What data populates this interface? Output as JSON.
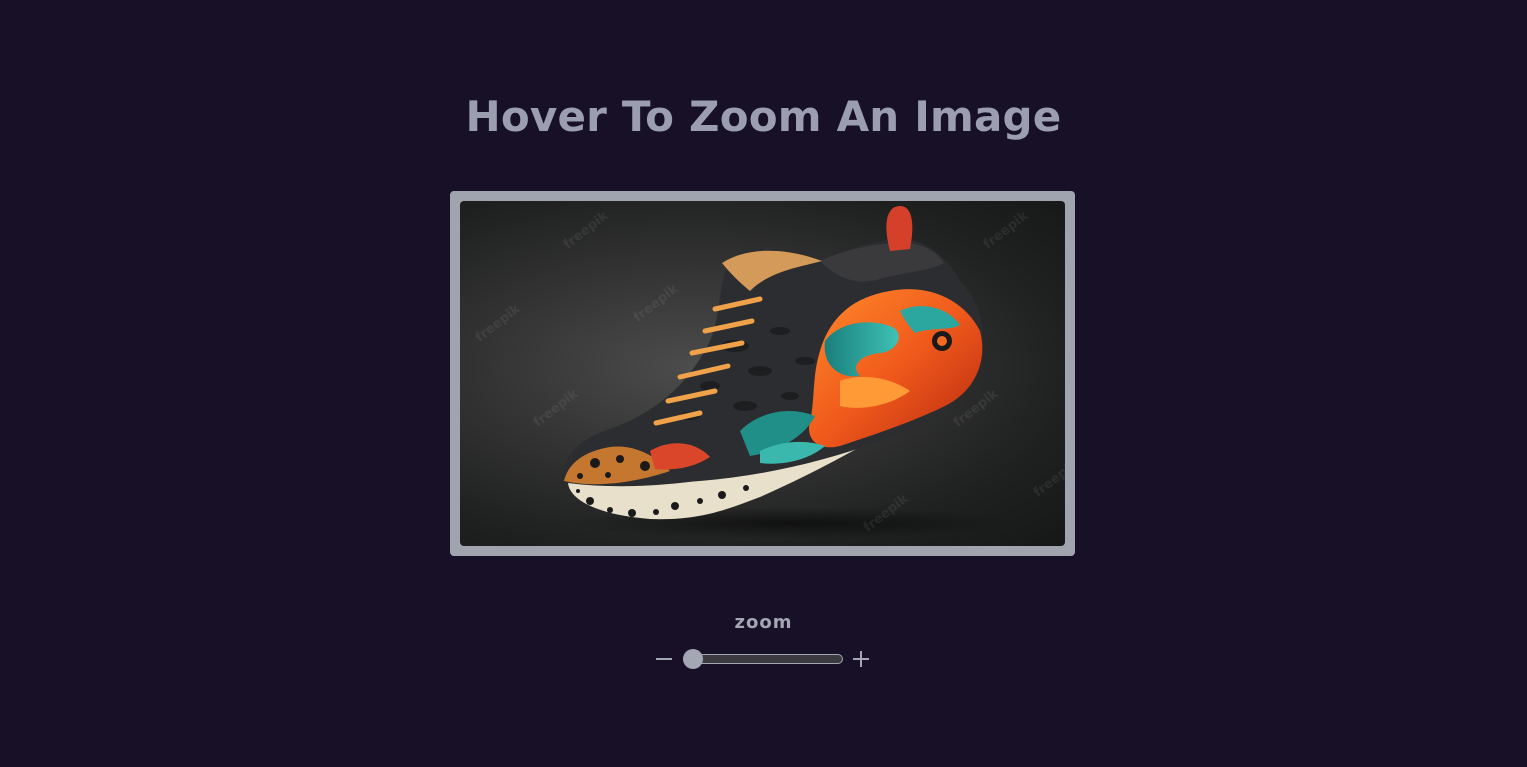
{
  "page": {
    "title": "Hover To Zoom An Image"
  },
  "image": {
    "subject": "colorful sneaker",
    "watermark": "freepik"
  },
  "zoom": {
    "label": "zoom",
    "minus_icon": "minus-icon",
    "plus_icon": "plus-icon",
    "min": 1,
    "max": 3,
    "value": 1
  },
  "colors": {
    "background": "#181026",
    "text": "#9a9eae",
    "frame": "#a0a4af"
  }
}
